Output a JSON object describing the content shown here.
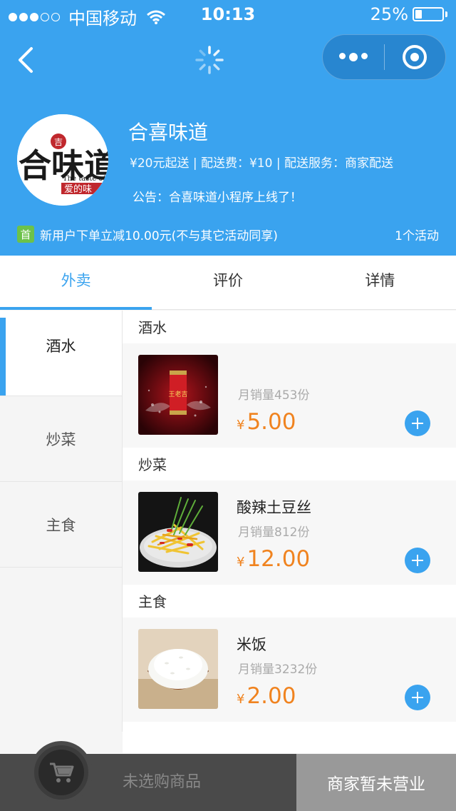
{
  "status_bar": {
    "carrier": "中国移动",
    "time": "10:13",
    "battery": "25%",
    "battery_level": 0.25
  },
  "shop": {
    "name": "合喜味道",
    "meta": "¥20元起送 | 配送费：¥10 | 配送服务：商家配送",
    "notice": "公告：合喜味道小程序上线了！",
    "promo_badge": "首",
    "promo_text": "新用户下单立减10.00元(不与其它活动同享)",
    "promo_count": "1个活动",
    "logo_text_main": "合味道",
    "logo_text_en": "The taste of l",
    "logo_text_sub": "爱的味"
  },
  "tabs": [
    {
      "label": "外卖",
      "active": true
    },
    {
      "label": "评价",
      "active": false
    },
    {
      "label": "详情",
      "active": false
    }
  ],
  "sidebar": {
    "items": [
      {
        "label": "酒水",
        "active": true
      },
      {
        "label": "炒菜",
        "active": false
      },
      {
        "label": "主食",
        "active": false
      }
    ]
  },
  "menu": {
    "categories": [
      {
        "title": "酒水",
        "dish": {
          "name": "",
          "sales": "月销量453份",
          "currency": "¥",
          "price": "5.00",
          "image": "red-can-drink"
        }
      },
      {
        "title": "炒菜",
        "dish": {
          "name": "酸辣土豆丝",
          "sales": "月销量812份",
          "currency": "¥",
          "price": "12.00",
          "image": "potato-shreds"
        }
      },
      {
        "title": "主食",
        "dish": {
          "name": "米饭",
          "sales": "月销量3232份",
          "currency": "¥",
          "price": "2.00",
          "image": "rice-bowl"
        }
      }
    ]
  },
  "bottom_bar": {
    "cart_status": "未选购商品",
    "checkout_label": "商家暂未营业"
  },
  "colors": {
    "primary": "#3aa3ef",
    "price": "#f0831f",
    "promo_badge": "#6cc24a"
  }
}
